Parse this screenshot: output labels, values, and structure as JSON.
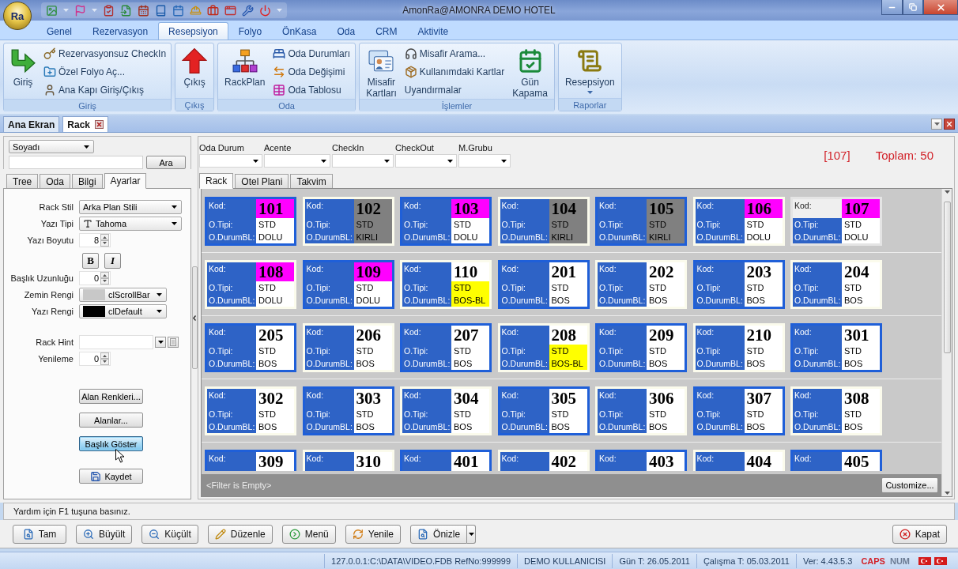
{
  "window": {
    "title": "AmonRa@AMONRA DEMO HOTEL",
    "app_button": "Ra"
  },
  "ribbon": {
    "tabs": [
      {
        "label": "Genel",
        "selected": false
      },
      {
        "label": "Rezervasyon",
        "selected": false
      },
      {
        "label": "Resepsiyon",
        "selected": true
      },
      {
        "label": "Folyo",
        "selected": false
      },
      {
        "label": "ÖnKasa",
        "selected": false
      },
      {
        "label": "Oda",
        "selected": false
      },
      {
        "label": "CRM",
        "selected": false
      },
      {
        "label": "Aktivite",
        "selected": false
      }
    ],
    "groups": [
      {
        "label": "Giriş",
        "items": [
          {
            "label": "Giriş",
            "kind": "large"
          },
          {
            "label": "Rezervasyonsuz CheckIn",
            "kind": "small"
          },
          {
            "label": "Özel Folyo Aç...",
            "kind": "small"
          },
          {
            "label": "Ana Kapı Giriş/Çıkış",
            "kind": "small"
          }
        ]
      },
      {
        "label": "Çıkış",
        "items": [
          {
            "label": "Çıkış",
            "kind": "large"
          }
        ]
      },
      {
        "label": "Oda",
        "items": [
          {
            "label": "RackPlan",
            "kind": "large"
          },
          {
            "label": "Oda Durumları",
            "kind": "small"
          },
          {
            "label": "Oda Değişimi",
            "kind": "small"
          },
          {
            "label": "Oda Tablosu",
            "kind": "small"
          }
        ]
      },
      {
        "label": "İşlemler",
        "items": [
          {
            "label": "Misafir Kartları",
            "kind": "large"
          },
          {
            "label": "Misafir Arama...",
            "kind": "small"
          },
          {
            "label": "Kullanımdaki Kartlar",
            "kind": "small"
          },
          {
            "label": "Uyandırmalar",
            "kind": "text"
          },
          {
            "label": "Gün Kapama",
            "kind": "large"
          }
        ]
      },
      {
        "label": "Raporlar",
        "items": [
          {
            "label": "Resepsiyon",
            "kind": "dropdown"
          }
        ]
      }
    ]
  },
  "document_tabs": [
    {
      "label": "Ana Ekran",
      "selected": false
    },
    {
      "label": "Rack",
      "selected": true
    }
  ],
  "search": {
    "field": "Soyadı",
    "button": "Ara"
  },
  "side_panel": {
    "tabs": [
      {
        "label": "Tree",
        "selected": false
      },
      {
        "label": "Oda",
        "selected": false
      },
      {
        "label": "Bilgi",
        "selected": false
      },
      {
        "label": "Ayarlar",
        "selected": true
      }
    ],
    "fields": [
      {
        "label": "Rack Stil",
        "kind": "select",
        "value": "Arka Plan Stili"
      },
      {
        "label": "Yazı Tipi",
        "kind": "font",
        "value": "Tahoma"
      },
      {
        "label": "Yazı Boyutu",
        "kind": "spin",
        "value": "8"
      },
      {
        "kind": "toggles",
        "items": [
          {
            "label": "B",
            "kind": "bold"
          },
          {
            "label": "I",
            "kind": "italic"
          }
        ]
      },
      {
        "label": "Başlık Uzunluğu",
        "kind": "spin",
        "value": "0"
      },
      {
        "label": "Zemin Rengi",
        "kind": "color",
        "value": "clScrollBar",
        "color": "#c8c8c8"
      },
      {
        "label": "Yazı Rengi",
        "kind": "color",
        "value": "clDefault",
        "color": "#000000"
      },
      {
        "label": "Rack Hint",
        "kind": "combo"
      },
      {
        "label": "Yenileme",
        "kind": "spin",
        "value": "0"
      }
    ],
    "buttons": [
      {
        "label": "Alan Renkleri...",
        "kind": "text",
        "highlighted": false
      },
      {
        "label": "Alanlar...",
        "kind": "text",
        "highlighted": false
      },
      {
        "label": "Başlık Göster",
        "kind": "text",
        "highlighted": true
      },
      {
        "label": "Kaydet",
        "kind": "save",
        "highlighted": false
      }
    ]
  },
  "filters": {
    "items": [
      {
        "label": "Oda Durum"
      },
      {
        "label": "Acente"
      },
      {
        "label": "CheckIn"
      },
      {
        "label": "CheckOut"
      },
      {
        "label": "M.Grubu"
      }
    ],
    "current_room": "[107]",
    "total": "Toplam: 50"
  },
  "rack": {
    "tabs": [
      {
        "label": "Rack",
        "selected": true
      },
      {
        "label": "Otel Plani",
        "selected": false
      },
      {
        "label": "Takvim",
        "selected": false
      }
    ],
    "rooms": [
      {
        "framed": true,
        "selected": false,
        "fields": [
          {
            "label": "Kod:",
            "value": "101",
            "color": "#ff00ff"
          },
          {
            "label": "O.Tipi:",
            "value": "STD",
            "color": "#ffffff"
          },
          {
            "label": "O.DurumBL:",
            "value": "DOLU",
            "color": "#ffffff"
          }
        ]
      },
      {
        "framed": false,
        "selected": false,
        "fields": [
          {
            "label": "Kod:",
            "value": "102",
            "color": "#808080"
          },
          {
            "label": "O.Tipi:",
            "value": "STD",
            "color": "#808080"
          },
          {
            "label": "O.DurumBL:",
            "value": "KIRLI",
            "color": "#808080"
          }
        ]
      },
      {
        "framed": true,
        "selected": false,
        "fields": [
          {
            "label": "Kod:",
            "value": "103",
            "color": "#ff00ff"
          },
          {
            "label": "O.Tipi:",
            "value": "STD",
            "color": "#ffffff"
          },
          {
            "label": "O.DurumBL:",
            "value": "DOLU",
            "color": "#ffffff"
          }
        ]
      },
      {
        "framed": false,
        "selected": false,
        "fields": [
          {
            "label": "Kod:",
            "value": "104",
            "color": "#808080"
          },
          {
            "label": "O.Tipi:",
            "value": "STD",
            "color": "#808080"
          },
          {
            "label": "O.DurumBL:",
            "value": "KIRLI",
            "color": "#808080"
          }
        ]
      },
      {
        "framed": true,
        "selected": false,
        "fields": [
          {
            "label": "Kod:",
            "value": "105",
            "color": "#808080"
          },
          {
            "label": "O.Tipi:",
            "value": "STD",
            "color": "#808080"
          },
          {
            "label": "O.DurumBL:",
            "value": "KIRLI",
            "color": "#808080"
          }
        ]
      },
      {
        "framed": false,
        "selected": false,
        "fields": [
          {
            "label": "Kod:",
            "value": "106",
            "color": "#ff00ff"
          },
          {
            "label": "O.Tipi:",
            "value": "STD",
            "color": "#ffffff"
          },
          {
            "label": "O.DurumBL:",
            "value": "DOLU",
            "color": "#ffffff"
          }
        ]
      },
      {
        "framed": false,
        "selected": true,
        "fields": [
          {
            "label": "Kod:",
            "value": "107",
            "color": "#ff00ff"
          },
          {
            "label": "O.Tipi:",
            "value": "STD",
            "color": "#ffffff"
          },
          {
            "label": "O.DurumBL:",
            "value": "DOLU",
            "color": "#ffffff"
          }
        ]
      },
      {
        "framed": false,
        "selected": false,
        "fields": [
          {
            "label": "Kod:",
            "value": "108",
            "color": "#ff00ff"
          },
          {
            "label": "O.Tipi:",
            "value": "STD",
            "color": "#ffffff"
          },
          {
            "label": "O.DurumBL:",
            "value": "DOLU",
            "color": "#ffffff"
          }
        ]
      },
      {
        "framed": true,
        "selected": false,
        "fields": [
          {
            "label": "Kod:",
            "value": "109",
            "color": "#ff00ff"
          },
          {
            "label": "O.Tipi:",
            "value": "STD",
            "color": "#ffffff"
          },
          {
            "label": "O.DurumBL:",
            "value": "DOLU",
            "color": "#ffffff"
          }
        ]
      },
      {
        "framed": false,
        "selected": false,
        "fields": [
          {
            "label": "Kod:",
            "value": "110",
            "color": "#ffffff"
          },
          {
            "label": "O.Tipi:",
            "value": "STD",
            "color": "#ffff00"
          },
          {
            "label": "O.DurumBL:",
            "value": "BOS-BL",
            "color": "#ffff00"
          }
        ]
      },
      {
        "framed": true,
        "selected": false,
        "fields": [
          {
            "label": "Kod:",
            "value": "201",
            "color": "#ffffff"
          },
          {
            "label": "O.Tipi:",
            "value": "STD",
            "color": "#ffffff"
          },
          {
            "label": "O.DurumBL:",
            "value": "BOS",
            "color": "#ffffff"
          }
        ]
      },
      {
        "framed": false,
        "selected": false,
        "fields": [
          {
            "label": "Kod:",
            "value": "202",
            "color": "#ffffff"
          },
          {
            "label": "O.Tipi:",
            "value": "STD",
            "color": "#ffffff"
          },
          {
            "label": "O.DurumBL:",
            "value": "BOS",
            "color": "#ffffff"
          }
        ]
      },
      {
        "framed": true,
        "selected": false,
        "fields": [
          {
            "label": "Kod:",
            "value": "203",
            "color": "#ffffff"
          },
          {
            "label": "O.Tipi:",
            "value": "STD",
            "color": "#ffffff"
          },
          {
            "label": "O.DurumBL:",
            "value": "BOS",
            "color": "#ffffff"
          }
        ]
      },
      {
        "framed": false,
        "selected": false,
        "fields": [
          {
            "label": "Kod:",
            "value": "204",
            "color": "#ffffff"
          },
          {
            "label": "O.Tipi:",
            "value": "STD",
            "color": "#ffffff"
          },
          {
            "label": "O.DurumBL:",
            "value": "BOS",
            "color": "#ffffff"
          }
        ]
      },
      {
        "framed": true,
        "selected": false,
        "fields": [
          {
            "label": "Kod:",
            "value": "205",
            "color": "#ffffff"
          },
          {
            "label": "O.Tipi:",
            "value": "STD",
            "color": "#ffffff"
          },
          {
            "label": "O.DurumBL:",
            "value": "BOS",
            "color": "#ffffff"
          }
        ]
      },
      {
        "framed": false,
        "selected": false,
        "fields": [
          {
            "label": "Kod:",
            "value": "206",
            "color": "#ffffff"
          },
          {
            "label": "O.Tipi:",
            "value": "STD",
            "color": "#ffffff"
          },
          {
            "label": "O.DurumBL:",
            "value": "BOS",
            "color": "#ffffff"
          }
        ]
      },
      {
        "framed": true,
        "selected": false,
        "fields": [
          {
            "label": "Kod:",
            "value": "207",
            "color": "#ffffff"
          },
          {
            "label": "O.Tipi:",
            "value": "STD",
            "color": "#ffffff"
          },
          {
            "label": "O.DurumBL:",
            "value": "BOS",
            "color": "#ffffff"
          }
        ]
      },
      {
        "framed": false,
        "selected": false,
        "fields": [
          {
            "label": "Kod:",
            "value": "208",
            "color": "#ffffff"
          },
          {
            "label": "O.Tipi:",
            "value": "STD",
            "color": "#ffff00"
          },
          {
            "label": "O.DurumBL:",
            "value": "BOS-BL",
            "color": "#ffff00"
          }
        ]
      },
      {
        "framed": true,
        "selected": false,
        "fields": [
          {
            "label": "Kod:",
            "value": "209",
            "color": "#ffffff"
          },
          {
            "label": "O.Tipi:",
            "value": "STD",
            "color": "#ffffff"
          },
          {
            "label": "O.DurumBL:",
            "value": "BOS",
            "color": "#ffffff"
          }
        ]
      },
      {
        "framed": false,
        "selected": false,
        "fields": [
          {
            "label": "Kod:",
            "value": "210",
            "color": "#ffffff"
          },
          {
            "label": "O.Tipi:",
            "value": "STD",
            "color": "#ffffff"
          },
          {
            "label": "O.DurumBL:",
            "value": "BOS",
            "color": "#ffffff"
          }
        ]
      },
      {
        "framed": true,
        "selected": false,
        "fields": [
          {
            "label": "Kod:",
            "value": "301",
            "color": "#ffffff"
          },
          {
            "label": "O.Tipi:",
            "value": "STD",
            "color": "#ffffff"
          },
          {
            "label": "O.DurumBL:",
            "value": "BOS",
            "color": "#ffffff"
          }
        ]
      },
      {
        "framed": false,
        "selected": false,
        "fields": [
          {
            "label": "Kod:",
            "value": "302",
            "color": "#ffffff"
          },
          {
            "label": "O.Tipi:",
            "value": "STD",
            "color": "#ffffff"
          },
          {
            "label": "O.DurumBL:",
            "value": "BOS",
            "color": "#ffffff"
          }
        ]
      },
      {
        "framed": true,
        "selected": false,
        "fields": [
          {
            "label": "Kod:",
            "value": "303",
            "color": "#ffffff"
          },
          {
            "label": "O.Tipi:",
            "value": "STD",
            "color": "#ffffff"
          },
          {
            "label": "O.DurumBL:",
            "value": "BOS",
            "color": "#ffffff"
          }
        ]
      },
      {
        "framed": false,
        "selected": false,
        "fields": [
          {
            "label": "Kod:",
            "value": "304",
            "color": "#ffffff"
          },
          {
            "label": "O.Tipi:",
            "value": "STD",
            "color": "#ffffff"
          },
          {
            "label": "O.DurumBL:",
            "value": "BOS",
            "color": "#ffffff"
          }
        ]
      },
      {
        "framed": true,
        "selected": false,
        "fields": [
          {
            "label": "Kod:",
            "value": "305",
            "color": "#ffffff"
          },
          {
            "label": "O.Tipi:",
            "value": "STD",
            "color": "#ffffff"
          },
          {
            "label": "O.DurumBL:",
            "value": "BOS",
            "color": "#ffffff"
          }
        ]
      },
      {
        "framed": false,
        "selected": false,
        "fields": [
          {
            "label": "Kod:",
            "value": "306",
            "color": "#ffffff"
          },
          {
            "label": "O.Tipi:",
            "value": "STD",
            "color": "#ffffff"
          },
          {
            "label": "O.DurumBL:",
            "value": "BOS",
            "color": "#ffffff"
          }
        ]
      },
      {
        "framed": true,
        "selected": false,
        "fields": [
          {
            "label": "Kod:",
            "value": "307",
            "color": "#ffffff"
          },
          {
            "label": "O.Tipi:",
            "value": "STD",
            "color": "#ffffff"
          },
          {
            "label": "O.DurumBL:",
            "value": "BOS",
            "color": "#ffffff"
          }
        ]
      },
      {
        "framed": false,
        "selected": false,
        "fields": [
          {
            "label": "Kod:",
            "value": "308",
            "color": "#ffffff"
          },
          {
            "label": "O.Tipi:",
            "value": "STD",
            "color": "#ffffff"
          },
          {
            "label": "O.DurumBL:",
            "value": "BOS",
            "color": "#ffffff"
          }
        ]
      },
      {
        "framed": true,
        "selected": false,
        "fields": [
          {
            "label": "Kod:",
            "value": "309",
            "color": "#ffffff"
          }
        ]
      },
      {
        "framed": false,
        "selected": false,
        "fields": [
          {
            "label": "Kod:",
            "value": "310",
            "color": "#ffffff"
          }
        ]
      },
      {
        "framed": true,
        "selected": false,
        "fields": [
          {
            "label": "Kod:",
            "value": "401",
            "color": "#ffffff"
          }
        ]
      },
      {
        "framed": false,
        "selected": false,
        "fields": [
          {
            "label": "Kod:",
            "value": "402",
            "color": "#ffffff"
          }
        ]
      },
      {
        "framed": true,
        "selected": false,
        "fields": [
          {
            "label": "Kod:",
            "value": "403",
            "color": "#ffffff"
          }
        ]
      },
      {
        "framed": false,
        "selected": false,
        "fields": [
          {
            "label": "Kod:",
            "value": "404",
            "color": "#ffffff"
          }
        ]
      },
      {
        "framed": true,
        "selected": false,
        "fields": [
          {
            "label": "Kod:",
            "value": "405",
            "color": "#ffffff"
          }
        ]
      }
    ],
    "filter_text": "<Filter is Empty>",
    "customize_button": "Customize..."
  },
  "help_text": "Yardım için F1 tuşuna basınız.",
  "toolbar": {
    "buttons": [
      {
        "label": "Tam",
        "kind": "button"
      },
      {
        "label": "Büyült",
        "kind": "button"
      },
      {
        "label": "Küçült",
        "kind": "button"
      },
      {
        "label": "Düzenle",
        "kind": "button"
      },
      {
        "label": "Menü",
        "kind": "button"
      },
      {
        "label": "Yenile",
        "kind": "button"
      },
      {
        "label": "Önizle",
        "kind": "split"
      }
    ],
    "close_button": "Kapat"
  },
  "status_bar": {
    "sections": [
      "127.0.0.1:C:\\DATA\\VIDEO.FDB RefNo:999999",
      "DEMO KULLANICISI",
      "Gün T: 26.05.2011",
      "Çalışma T: 05.03.2011",
      "Ver: 4.43.5.3"
    ],
    "keys": [
      {
        "label": "CAPS",
        "on": true
      },
      {
        "label": "NUM",
        "on": false
      }
    ]
  }
}
